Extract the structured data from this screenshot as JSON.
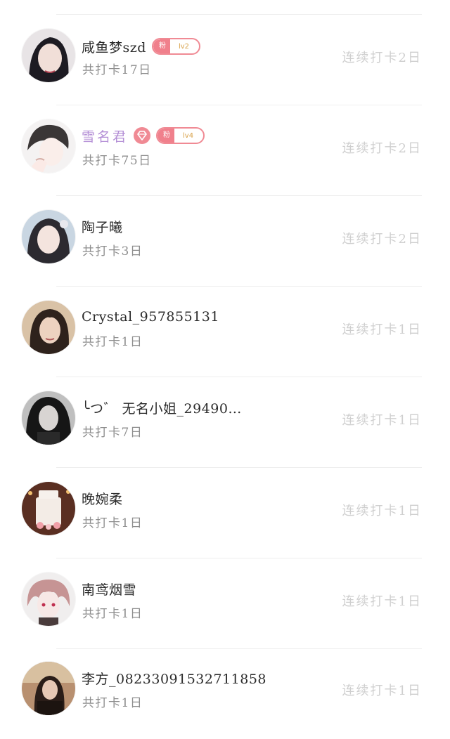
{
  "users": [
    {
      "name": "咸鱼梦szd",
      "badge_text": "粉",
      "level": "lv2",
      "total": "共打卡17日",
      "streak": "连续打卡2日",
      "vip": false
    },
    {
      "name": "雪名君",
      "badge_text": "粉",
      "level": "lv4",
      "total": "共打卡75日",
      "streak": "连续打卡2日",
      "vip": true
    },
    {
      "name": "陶子曦",
      "total": "共打卡3日",
      "streak": "连续打卡2日",
      "vip": false
    },
    {
      "name": "Crystal_957855131",
      "total": "共打卡1日",
      "streak": "连续打卡1日",
      "vip": false
    },
    {
      "name": "╰つ゛ 无名小姐_29490…",
      "total": "共打卡7日",
      "streak": "连续打卡1日",
      "vip": false
    },
    {
      "name": "晚婉柔",
      "total": "共打卡1日",
      "streak": "连续打卡1日",
      "vip": false
    },
    {
      "name": "南鸢烟雪",
      "total": "共打卡1日",
      "streak": "连续打卡1日",
      "vip": false
    },
    {
      "name": "李方_08233091532711858",
      "total": "共打卡1日",
      "streak": "连续打卡1日",
      "vip": false
    }
  ],
  "colors": {
    "accent_pink": "#f08a94",
    "vip_name": "#b48fd6",
    "level_gold": "#d8a24a",
    "streak_gray": "#cfcfcf"
  }
}
